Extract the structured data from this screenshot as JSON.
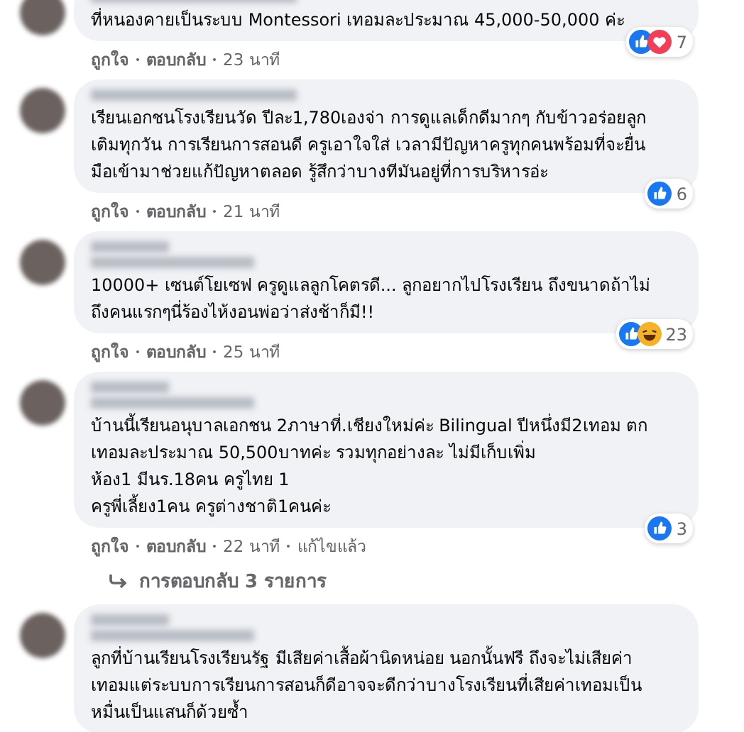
{
  "comments": [
    {
      "badge_line": false,
      "text": [
        "ที่หนองคายเป็นระบบ Montessori เทอมละประมาณ 45,000-50,000 ค่ะ"
      ],
      "meta": [
        "ถูกใจ",
        "ตอบกลับ",
        "23 นาที"
      ],
      "reactions": {
        "icons": [
          {
            "kind": "like"
          },
          {
            "kind": "love"
          }
        ],
        "count": "7"
      }
    },
    {
      "badge_line": false,
      "text": [
        "เรียนเอกชนโรงเรียนวัด ปีละ1,780เองจ่า การดูแลเด็กดีมากๆ กับข้าวอร่อยลูก",
        "เติมทุกวัน การเรียนการสอนดี ครูเอาใจใส่ เวลามีปัญหาครูทุกคนพร้อมที่จะยื่น",
        "มือเข้ามาช่วยแก้ปัญหาตลอด รู้สึกว่าบางทีมันอยู่ที่การบริหารอ่ะ"
      ],
      "meta": [
        "ถูกใจ",
        "ตอบกลับ",
        "21 นาที"
      ],
      "reactions": {
        "icons": [
          {
            "kind": "like"
          }
        ],
        "count": "6"
      }
    },
    {
      "badge_line": true,
      "text": [
        "10000+ เซนต์โยเซฟ ครูดูแลลูกโคตรดี... ลูกอยากไปโรงเรียน ถึงขนาดถ้าไม่",
        "ถึงคนแรกๆนี่ร้องไห้งอนพ่อว่าส่งช้าก็มี!!"
      ],
      "meta": [
        "ถูกใจ",
        "ตอบกลับ",
        "25 นาที"
      ],
      "reactions": {
        "icons": [
          {
            "kind": "like"
          },
          {
            "kind": "haha"
          }
        ],
        "count": "23"
      }
    },
    {
      "badge_line": true,
      "text": [
        "บ้านนี้เรียนอนุบาลเอกชน 2ภาษาที่.เชียงใหม่ค่ะ Bilingual ปีหนึ่งมี2เทอม ตก",
        "เทอมละประมาณ 50,500บาทค่ะ รวมทุกอย่างละ ไม่มีเก็บเพิ่ม",
        "ห้อง1 มีนร.18คน ครูไทย 1",
        "ครูพี่เลี้ยง1คน ครูต่างชาติ1คนค่ะ"
      ],
      "meta": [
        "ถูกใจ",
        "ตอบกลับ",
        "22 นาที",
        "แก้ไขแล้ว"
      ],
      "reactions": {
        "icons": [
          {
            "kind": "like"
          }
        ],
        "count": "3"
      },
      "replies": "การตอบกลับ 3 รายการ"
    },
    {
      "badge_line": true,
      "text": [
        "ลูกที่บ้านเรียนโรงเรียนรัฐ มีเสียค่าเสื้อผ้านิดหน่อย นอกนั้นฟรี ถึงจะไม่เสียค่า",
        "เทอมแต่ระบบการเรียนการสอนก็ดีอาจจะดีกว่าบางโรงเรียนที่เสียค่าเทอมเป็น",
        "หมื่นเป็นแสนก็ด้วยซ้ำ"
      ]
    }
  ]
}
